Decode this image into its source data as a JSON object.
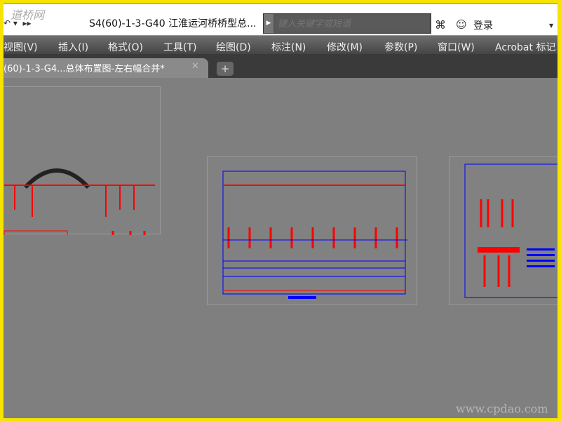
{
  "watermark_top": "道桥网",
  "watermark_bottom": "www.cpdao.com",
  "titlebar": {
    "title": "S4(60)-1-3-G40 江淮运河桥桥型总...",
    "search_placeholder": "键入关键字或短语",
    "login": "登录"
  },
  "menu": [
    "视图(V)",
    "插入(I)",
    "格式(O)",
    "工具(T)",
    "绘图(D)",
    "标注(N)",
    "修改(M)",
    "参数(P)",
    "窗口(W)",
    "Acrobat 标记"
  ],
  "tabs": [
    {
      "label": "(60)-1-3-G4...总体布置图-左右幅合并*",
      "active": true
    }
  ],
  "colors": {
    "canvas": "#7f7f7f",
    "border": "#f5e400",
    "drawing_blue": "#0000ff",
    "drawing_red": "#ff0000"
  }
}
